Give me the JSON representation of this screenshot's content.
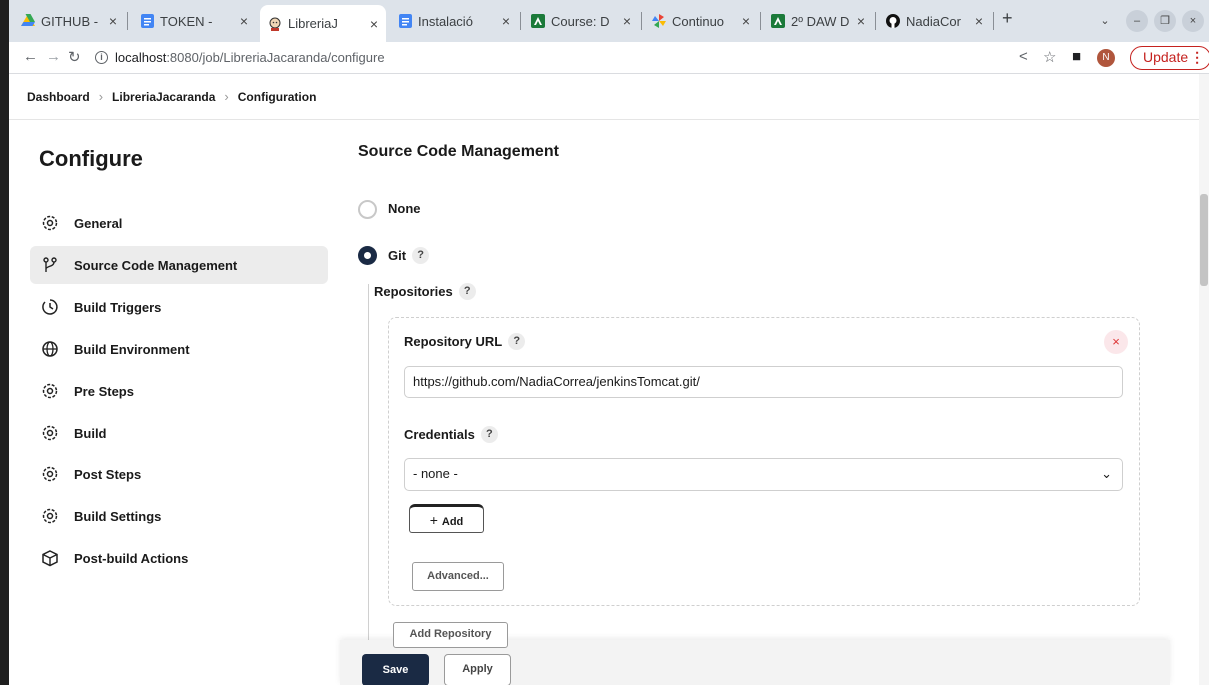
{
  "browser": {
    "tabs": [
      {
        "label": "GITHUB - ",
        "icon": "drive-icon",
        "color": "#1a73e8"
      },
      {
        "label": "TOKEN - ",
        "icon": "docs-icon",
        "color": "#1a73e8"
      },
      {
        "label": "LibreriaJ",
        "icon": "jenkins-icon",
        "color": "#c59b6d"
      },
      {
        "label": "Instalació",
        "icon": "docs-icon",
        "color": "#1a73e8"
      },
      {
        "label": "Course: D",
        "icon": "moodle-icon",
        "color": "#1b7a3a"
      },
      {
        "label": "Continuo",
        "icon": "pinwheel-icon",
        "color": "#e8710a"
      },
      {
        "label": "2º DAW D",
        "icon": "moodle-icon",
        "color": "#1b7a3a"
      },
      {
        "label": "NadiaCor",
        "icon": "github-icon",
        "color": "#111"
      }
    ],
    "new_tab": "+",
    "url_host": "localhost",
    "url_path": ":8080/job/LibreriaJacaranda/configure",
    "avatar_initial": "N",
    "update_label": "Update"
  },
  "breadcrumb": {
    "items": [
      "Dashboard",
      "LibreriaJacaranda",
      "Configuration"
    ]
  },
  "sidebar": {
    "title": "Configure",
    "items": [
      {
        "label": "General",
        "icon": "gear-icon"
      },
      {
        "label": "Source Code Management",
        "icon": "branch-icon"
      },
      {
        "label": "Build Triggers",
        "icon": "clock-icon"
      },
      {
        "label": "Build Environment",
        "icon": "globe-icon"
      },
      {
        "label": "Pre Steps",
        "icon": "gear-icon"
      },
      {
        "label": "Build",
        "icon": "gear-icon"
      },
      {
        "label": "Post Steps",
        "icon": "gear-icon"
      },
      {
        "label": "Build Settings",
        "icon": "gear-icon"
      },
      {
        "label": "Post-build Actions",
        "icon": "cube-icon"
      }
    ]
  },
  "scm": {
    "title": "Source Code Management",
    "none_label": "None",
    "git_label": "Git",
    "repositories_label": "Repositories",
    "repo_url_label": "Repository URL",
    "repo_url_value": "https://github.com/NadiaCorrea/jenkinsTomcat.git/",
    "credentials_label": "Credentials",
    "credentials_value": "- none -",
    "add_label": "Add",
    "advanced_label": "Advanced...",
    "add_repo_label": "Add Repository",
    "help": "?"
  },
  "footer": {
    "save_label": "Save",
    "apply_label": "Apply"
  }
}
